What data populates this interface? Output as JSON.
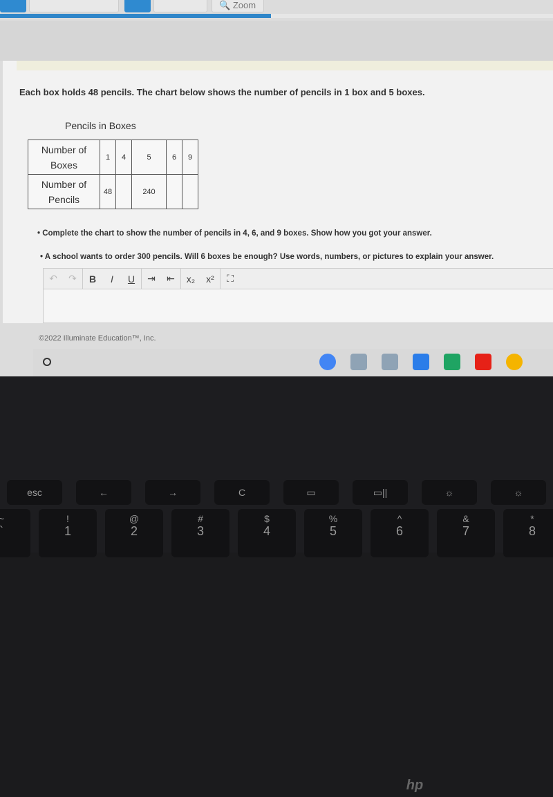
{
  "browser": {
    "toolbar_buttons": [
      "",
      "",
      "",
      "",
      "Zoom"
    ],
    "progress_percent": 49
  },
  "question": {
    "text": "Each box holds 48 pencils. The chart below shows the number of pencils in 1 box and 5 boxes."
  },
  "table": {
    "title": "Pencils in Boxes",
    "row1_header": "Number of Boxes",
    "row1_values": [
      "1",
      "4",
      "5",
      "6",
      "9"
    ],
    "row2_header": "Number of Pencils",
    "row2_values": [
      "48",
      "",
      "240",
      "",
      ""
    ]
  },
  "bullets": [
    "• Complete the chart to show the number of pencils in 4, 6, and 9 boxes. Show how you got your answer.",
    "• A school wants to order 300 pencils. Will 6 boxes be enough? Use words, numbers, or pictures to explain your answer."
  ],
  "editor": {
    "tools": [
      {
        "icon": "undo-icon",
        "glyph": "↶"
      },
      {
        "icon": "redo-icon",
        "glyph": "↷"
      },
      {
        "icon": "bold-icon",
        "glyph": "B"
      },
      {
        "icon": "italic-icon",
        "glyph": "I"
      },
      {
        "icon": "underline-icon",
        "glyph": "U"
      },
      {
        "icon": "indent-icon",
        "glyph": "⇥"
      },
      {
        "icon": "outdent-icon",
        "glyph": "⇤"
      },
      {
        "icon": "subscript-icon",
        "glyph": "x₂"
      },
      {
        "icon": "superscript-icon",
        "glyph": "x²"
      },
      {
        "icon": "fullscreen-icon",
        "glyph": "⛶"
      }
    ],
    "value": ""
  },
  "footer": {
    "text": "©2022  Illuminate Education™, Inc."
  },
  "shelf": {
    "apps": [
      {
        "name": "chrome",
        "color": "#4285f4"
      },
      {
        "name": "window-1",
        "color": "#8fa3b5"
      },
      {
        "name": "window-2",
        "color": "#8fa3b5"
      },
      {
        "name": "docs",
        "color": "#2b7de9"
      },
      {
        "name": "sheets",
        "color": "#1fa463"
      },
      {
        "name": "youtube",
        "color": "#e62117"
      },
      {
        "name": "power-app",
        "color": "#f5b400"
      }
    ]
  },
  "keyboard": {
    "logo": "hp",
    "fn_row": [
      "esc",
      "←",
      "→",
      "C",
      "▭",
      "▭||",
      "☼",
      "☼"
    ],
    "num_row": [
      {
        "top": "~",
        "bottom": "`"
      },
      {
        "top": "!",
        "bottom": "1"
      },
      {
        "top": "@",
        "bottom": "2"
      },
      {
        "top": "#",
        "bottom": "3"
      },
      {
        "top": "$",
        "bottom": "4"
      },
      {
        "top": "%",
        "bottom": "5"
      },
      {
        "top": "^",
        "bottom": "6"
      },
      {
        "top": "&",
        "bottom": "7"
      },
      {
        "top": "*",
        "bottom": "8"
      }
    ]
  }
}
